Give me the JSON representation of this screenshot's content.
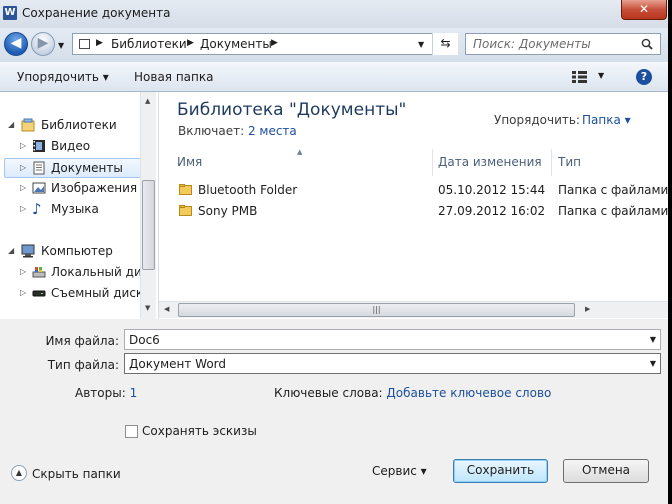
{
  "window": {
    "app_icon": "W",
    "title": "Сохранение документа",
    "close_label": "✕"
  },
  "nav": {
    "back_label": "◀",
    "forward_label": "▶",
    "address": [
      "Библиотеки",
      "Документы"
    ],
    "search_placeholder": "Поиск: Документы"
  },
  "toolbar": {
    "organize": "Упорядочить ▾",
    "new_folder": "Новая папка",
    "help": "?"
  },
  "sidebar": {
    "items": [
      {
        "label": "Библиотеки",
        "icon": "libraries-icon"
      },
      {
        "label": "Видео",
        "icon": "video-icon"
      },
      {
        "label": "Документы",
        "icon": "documents-icon",
        "selected": true
      },
      {
        "label": "Изображения",
        "icon": "pictures-icon"
      },
      {
        "label": "Музыка",
        "icon": "music-icon"
      },
      {
        "label": "Компьютер",
        "icon": "computer-icon"
      },
      {
        "label": "Локальный диск",
        "icon": "local-disk-icon"
      },
      {
        "label": "Съемный диск (",
        "icon": "removable-disk-icon"
      }
    ]
  },
  "library": {
    "title": "Библиотека \"Документы\"",
    "includes_label": "Включает:",
    "includes_value": "2 места",
    "arrange_label": "Упорядочить:",
    "arrange_value": "Папка ▾"
  },
  "columns": {
    "name": "Имя",
    "date": "Дата изменения",
    "type": "Тип"
  },
  "files": [
    {
      "name": "Bluetooth Folder",
      "date": "05.10.2012 15:44",
      "type": "Папка с файлами"
    },
    {
      "name": "Sony PMB",
      "date": "27.09.2012 16:02",
      "type": "Папка с файлами"
    }
  ],
  "form": {
    "filename_label": "Имя файла:",
    "filename_value": "Doc6",
    "filetype_label": "Тип файла:",
    "filetype_value": "Документ Word",
    "authors_label": "Авторы:",
    "authors_value": "1",
    "keywords_label": "Ключевые слова:",
    "keywords_value": "Добавьте ключевое слово",
    "thumbnails_label": "Сохранять эскизы"
  },
  "footer": {
    "hide_folders": "Скрыть папки",
    "tools": "Сервис ▾",
    "save": "Сохранить",
    "cancel": "Отмена"
  },
  "colors": {
    "accent": "#1c4f9c",
    "selected_bg": "#dcebfc",
    "title_blue": "#1e3a5f"
  }
}
